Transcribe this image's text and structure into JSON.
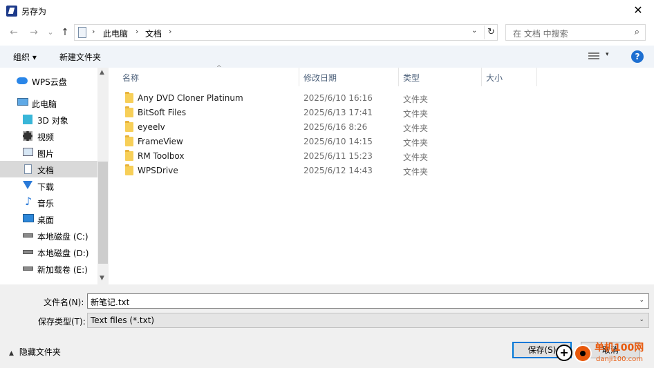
{
  "titlebar": {
    "title": "另存为",
    "close": "✕"
  },
  "nav": {
    "back": "←",
    "forward": "→",
    "recent": "⌄",
    "up": "↑",
    "crumbs": [
      "此电脑",
      "文档"
    ],
    "sep": "›",
    "drop": "⌄",
    "refresh": "↻",
    "search_placeholder": "在 文档 中搜索",
    "search_icon": "⌕"
  },
  "toolbar": {
    "organize": "组织 ▾",
    "new_folder": "新建文件夹",
    "view_drop": "▾",
    "help": "?"
  },
  "sidebar": {
    "items": [
      {
        "label": "WPS云盘",
        "icon": "cloud-icon"
      },
      {
        "label": "此电脑",
        "icon": "computer-icon"
      },
      {
        "label": "3D 对象",
        "icon": "cube-icon"
      },
      {
        "label": "视频",
        "icon": "film-icon"
      },
      {
        "label": "图片",
        "icon": "image-icon"
      },
      {
        "label": "文档",
        "icon": "document-icon",
        "selected": true
      },
      {
        "label": "下载",
        "icon": "download-icon"
      },
      {
        "label": "音乐",
        "icon": "music-icon"
      },
      {
        "label": "桌面",
        "icon": "desktop-icon"
      },
      {
        "label": "本地磁盘 (C:)",
        "icon": "drive-icon"
      },
      {
        "label": "本地磁盘 (D:)",
        "icon": "drive-icon"
      },
      {
        "label": "新加载卷 (E:)",
        "icon": "drive-icon"
      }
    ],
    "scroll_up": "▲",
    "scroll_down": "▼"
  },
  "filelist": {
    "columns": [
      "名称",
      "修改日期",
      "类型",
      "大小"
    ],
    "sort_arrow": "^",
    "rows": [
      {
        "name": "Any DVD Cloner Platinum",
        "date": "2025/6/10 16:16",
        "type": "文件夹"
      },
      {
        "name": "BitSoft Files",
        "date": "2025/6/13 17:41",
        "type": "文件夹"
      },
      {
        "name": "eyeelv",
        "date": "2025/6/16 8:26",
        "type": "文件夹"
      },
      {
        "name": "FrameView",
        "date": "2025/6/10 14:15",
        "type": "文件夹"
      },
      {
        "name": "RM Toolbox",
        "date": "2025/6/11 15:23",
        "type": "文件夹"
      },
      {
        "name": "WPSDrive",
        "date": "2025/6/12 14:43",
        "type": "文件夹"
      }
    ]
  },
  "bottom": {
    "filename_label": "文件名(N):",
    "filename_value": "新笔记.txt",
    "filetype_label": "保存类型(T):",
    "filetype_value": "Text files (*.txt)",
    "hide_folders": "隐藏文件夹",
    "hide_chev": "▲",
    "save": "保存(S)",
    "cancel": "取消",
    "combo_drop": "⌄"
  },
  "watermark": {
    "plus": "+",
    "line1": "单机100网",
    "line2": "danji100.com"
  }
}
